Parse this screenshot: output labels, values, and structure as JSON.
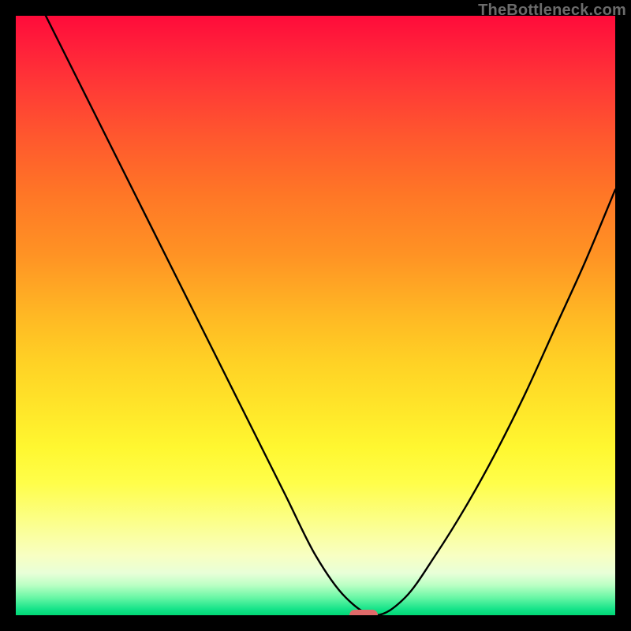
{
  "watermark": "TheBottleneck.com",
  "colors": {
    "curve": "#000000",
    "marker": "#e06a6a",
    "frame": "#000000"
  },
  "chart_data": {
    "type": "line",
    "title": "",
    "xlabel": "",
    "ylabel": "",
    "xlim": [
      0,
      100
    ],
    "ylim": [
      0,
      100
    ],
    "grid": false,
    "series": [
      {
        "name": "bottleneck-curve",
        "x": [
          0,
          5,
          10,
          15,
          20,
          25,
          30,
          35,
          40,
          45,
          50,
          55,
          60,
          65,
          70,
          75,
          80,
          85,
          90,
          95,
          100
        ],
        "values": [
          110,
          100,
          90,
          80,
          70,
          60,
          50,
          40,
          30,
          20,
          10,
          3,
          0,
          3,
          10,
          18,
          27,
          37,
          48,
          59,
          71
        ]
      }
    ],
    "annotations": [
      {
        "name": "min-marker",
        "x": 58,
        "y": 0,
        "shape": "pill"
      }
    ]
  }
}
